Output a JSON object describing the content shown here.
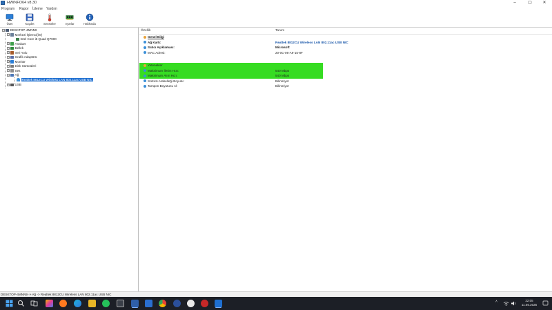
{
  "window": {
    "title": "HWiNFO64 v8.30"
  },
  "menu": {
    "items": [
      "Program",
      "Rapor",
      "İzleme",
      "Yardım"
    ]
  },
  "toolbar": {
    "buttons": [
      {
        "label": "Özet",
        "icon": "monitor-icon",
        "color": "#2b7fd8"
      },
      {
        "label": "Kaydet",
        "icon": "save-icon",
        "color": "#3a6bc4"
      },
      {
        "label": "Sensörler",
        "icon": "thermometer-icon",
        "color": "#d03a2a"
      },
      {
        "label": "Ayarlar",
        "icon": "memory-card-icon",
        "color": "#2f8a3a"
      },
      {
        "label": "Hakkında",
        "icon": "info-icon",
        "color": "#2463b8"
      }
    ]
  },
  "tree": {
    "root": "DESKTOP-4MNN9",
    "items": [
      {
        "label": "Merkezi İşlemci(ler)",
        "icon": "cpu-icon"
      },
      {
        "label": "Intel Core i5 Quad Q7900",
        "icon": "cpu-chip-icon"
      },
      {
        "label": "Anakart",
        "icon": "motherboard-icon"
      },
      {
        "label": "Bellek",
        "icon": "memory-icon"
      },
      {
        "label": "Veri Yolu",
        "icon": "bus-icon"
      },
      {
        "label": "Grafik Adaptörü",
        "icon": "gpu-icon"
      },
      {
        "label": "Monitör",
        "icon": "monitor-icon"
      },
      {
        "label": "Disk Sürücüleri",
        "icon": "disk-icon"
      },
      {
        "label": "Ses",
        "icon": "audio-icon"
      },
      {
        "label": "Ağ",
        "icon": "network-icon"
      },
      {
        "label": "Realtek 8812CU Wireless LAN 802.11ac USB NIC",
        "icon": "wifi-icon"
      },
      {
        "label": "USB",
        "icon": "usb-icon"
      }
    ]
  },
  "details": {
    "columns": [
      "Özellik",
      "Tanım"
    ],
    "rows": [
      {
        "field": "Genel Bilgi",
        "value": "",
        "style": "section"
      },
      {
        "field": "Ağ Kartı:",
        "value": "Realtek 8812CU Wireless LAN 802.11ac USB NIC",
        "style": "blue"
      },
      {
        "field": "Satıcı Açıklaması:",
        "value": "Microsoft",
        "style": "bold"
      },
      {
        "field": "MAC Adresi:",
        "value": "20-0C-06-A9-15-8F",
        "style": "plain"
      },
      {
        "field": "",
        "value": "",
        "style": "blank"
      },
      {
        "field": "Yetenekler",
        "value": "",
        "style": "section-green"
      },
      {
        "field": "Maksimum İletim Hızı:",
        "value": "540 Mbps",
        "style": "green"
      },
      {
        "field": "Maksimum Alım Hızı:",
        "value": "540 Mbps",
        "style": "green"
      },
      {
        "field": "Sürücü Arabelleği Boyutu:",
        "value": "Bilinmiyor",
        "style": "plain"
      },
      {
        "field": "Tampon Boyutunu Al:",
        "value": "Bilinmiyor",
        "style": "plain"
      }
    ]
  },
  "status": {
    "text": "DESKTOP-4MNN9 -> Ağ -> Realtek 8812CU Wireless LAN 802.11ac USB NIC"
  },
  "taskbar": {
    "clock_time": "22:05",
    "clock_date": "11.05.2025"
  }
}
